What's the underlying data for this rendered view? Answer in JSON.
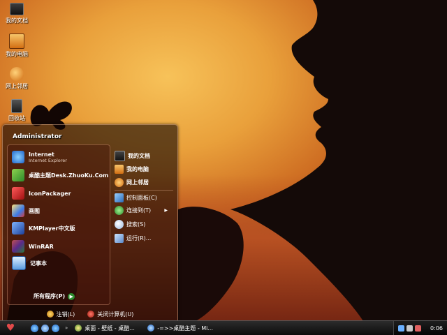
{
  "desktop": {
    "icons": [
      {
        "label": "我的文档",
        "icon": "folder-icon"
      },
      {
        "label": "我的电脑",
        "icon": "computer-icon"
      },
      {
        "label": "网上邻居",
        "icon": "network-icon"
      },
      {
        "label": "回收站",
        "icon": "recycle-bin-icon"
      }
    ]
  },
  "start_menu": {
    "user_name": "Administrator",
    "programs": [
      {
        "title": "Internet",
        "subtitle": "Internet Explorer",
        "icon": "internet-explorer-icon"
      },
      {
        "title": "桌酷主题Desk.ZhuoKu.Com",
        "subtitle": "",
        "icon": "zhuoku-icon"
      },
      {
        "title": "IconPackager",
        "subtitle": "",
        "icon": "iconpackager-icon"
      },
      {
        "title": "画图",
        "subtitle": "",
        "icon": "paint-icon"
      },
      {
        "title": "KMPlayer中文版",
        "subtitle": "",
        "icon": "kmplayer-icon"
      },
      {
        "title": "WinRAR",
        "subtitle": "",
        "icon": "winrar-icon"
      },
      {
        "title": "记事本",
        "subtitle": "",
        "icon": "notepad-icon"
      }
    ],
    "all_programs": "所有程序(P)",
    "right_items": [
      {
        "label": "我的文档",
        "icon": "folder-icon"
      },
      {
        "label": "我的电脑",
        "icon": "computer-icon"
      },
      {
        "label": "网上邻居",
        "icon": "network-icon"
      },
      {
        "label": "控制面板(C)",
        "icon": "control-panel-icon"
      },
      {
        "label": "连接到(T)",
        "icon": "connect-icon"
      },
      {
        "label": "搜索(S)",
        "icon": "search-icon"
      },
      {
        "label": "运行(R)...",
        "icon": "run-icon"
      }
    ],
    "logoff": "注销(L)",
    "shutdown": "关闭计算机(U)"
  },
  "taskbar": {
    "tasks": [
      {
        "label": "桌面 - 壁纸 - 桌酷...",
        "icon": "zhuoku-browser-icon"
      },
      {
        "label": "-=>>桌酷主题 - Mi...",
        "icon": "internet-explorer-icon"
      }
    ],
    "quick_launch_more": "»",
    "clock": "0:06"
  }
}
